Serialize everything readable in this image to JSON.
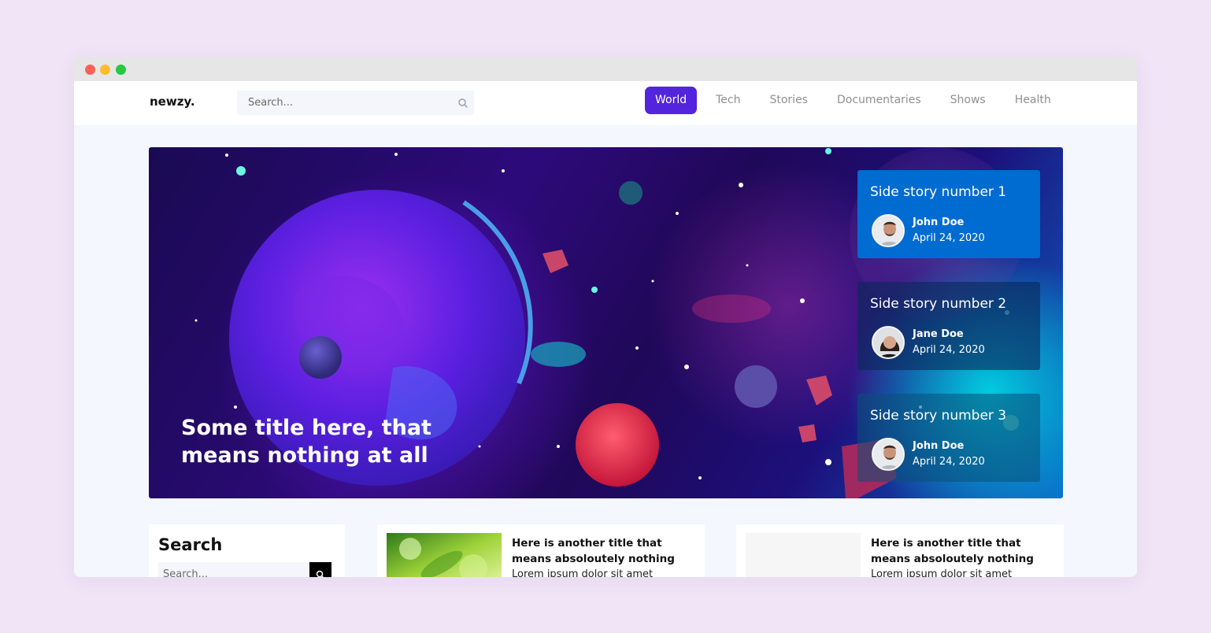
{
  "brand": {
    "logo": "newzy."
  },
  "nav": {
    "search_placeholder": "Search...",
    "links": [
      {
        "label": "World",
        "active": true
      },
      {
        "label": "Tech"
      },
      {
        "label": "Stories"
      },
      {
        "label": "Documentaries"
      },
      {
        "label": "Shows"
      },
      {
        "label": "Health"
      }
    ]
  },
  "hero": {
    "title": "Some title here, that means nothing at all",
    "side_stories": [
      {
        "title": "Side story number 1",
        "author": "John Doe",
        "date": "April 24, 2020"
      },
      {
        "title": "Side story number 2",
        "author": "Jane Doe",
        "date": "April 24, 2020"
      },
      {
        "title": "Side story number 3",
        "author": "John Doe",
        "date": "April 24, 2020"
      }
    ]
  },
  "sidebar": {
    "search_title": "Search",
    "search_placeholder": "Search..."
  },
  "articles": [
    {
      "title": "Here is another title that means absoloutely nothing",
      "excerpt": "Lorem ipsum dolor sit amet"
    },
    {
      "title": "Here is another title that means absoloutely nothing",
      "excerpt": "Lorem ipsum dolor sit amet"
    }
  ],
  "colors": {
    "accent": "#5224dc",
    "side_story_active": "#006bd1",
    "page_background": "#f1e4f6"
  }
}
